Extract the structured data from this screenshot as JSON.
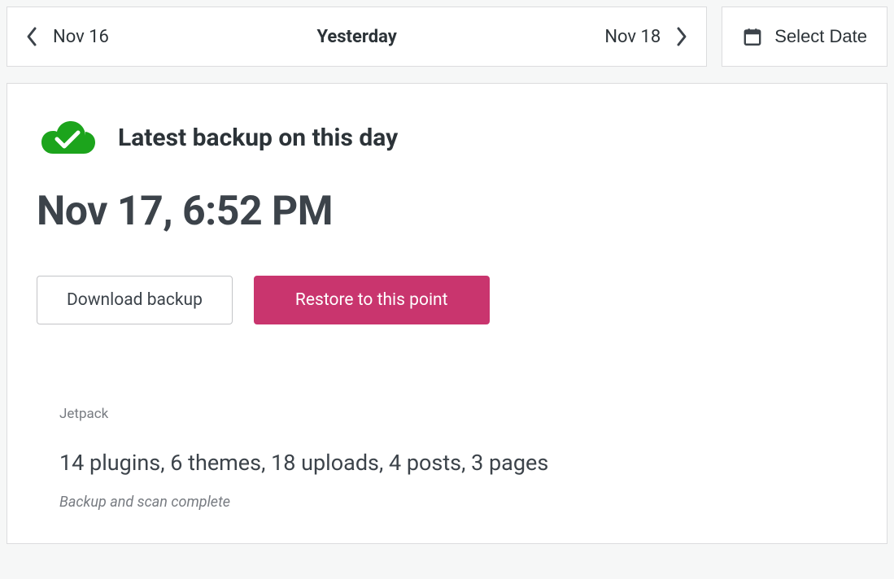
{
  "dateNav": {
    "prevLabel": "Nov 16",
    "centerLabel": "Yesterday",
    "nextLabel": "Nov 18",
    "selectDateLabel": "Select Date"
  },
  "card": {
    "headerTitle": "Latest backup on this day",
    "timestamp": "Nov 17, 6:52 PM",
    "downloadLabel": "Download backup",
    "restoreLabel": "Restore to this point",
    "source": "Jetpack",
    "summary": "14 plugins, 6 themes, 18 uploads, 4 posts, 3 pages",
    "status": "Backup and scan complete"
  }
}
